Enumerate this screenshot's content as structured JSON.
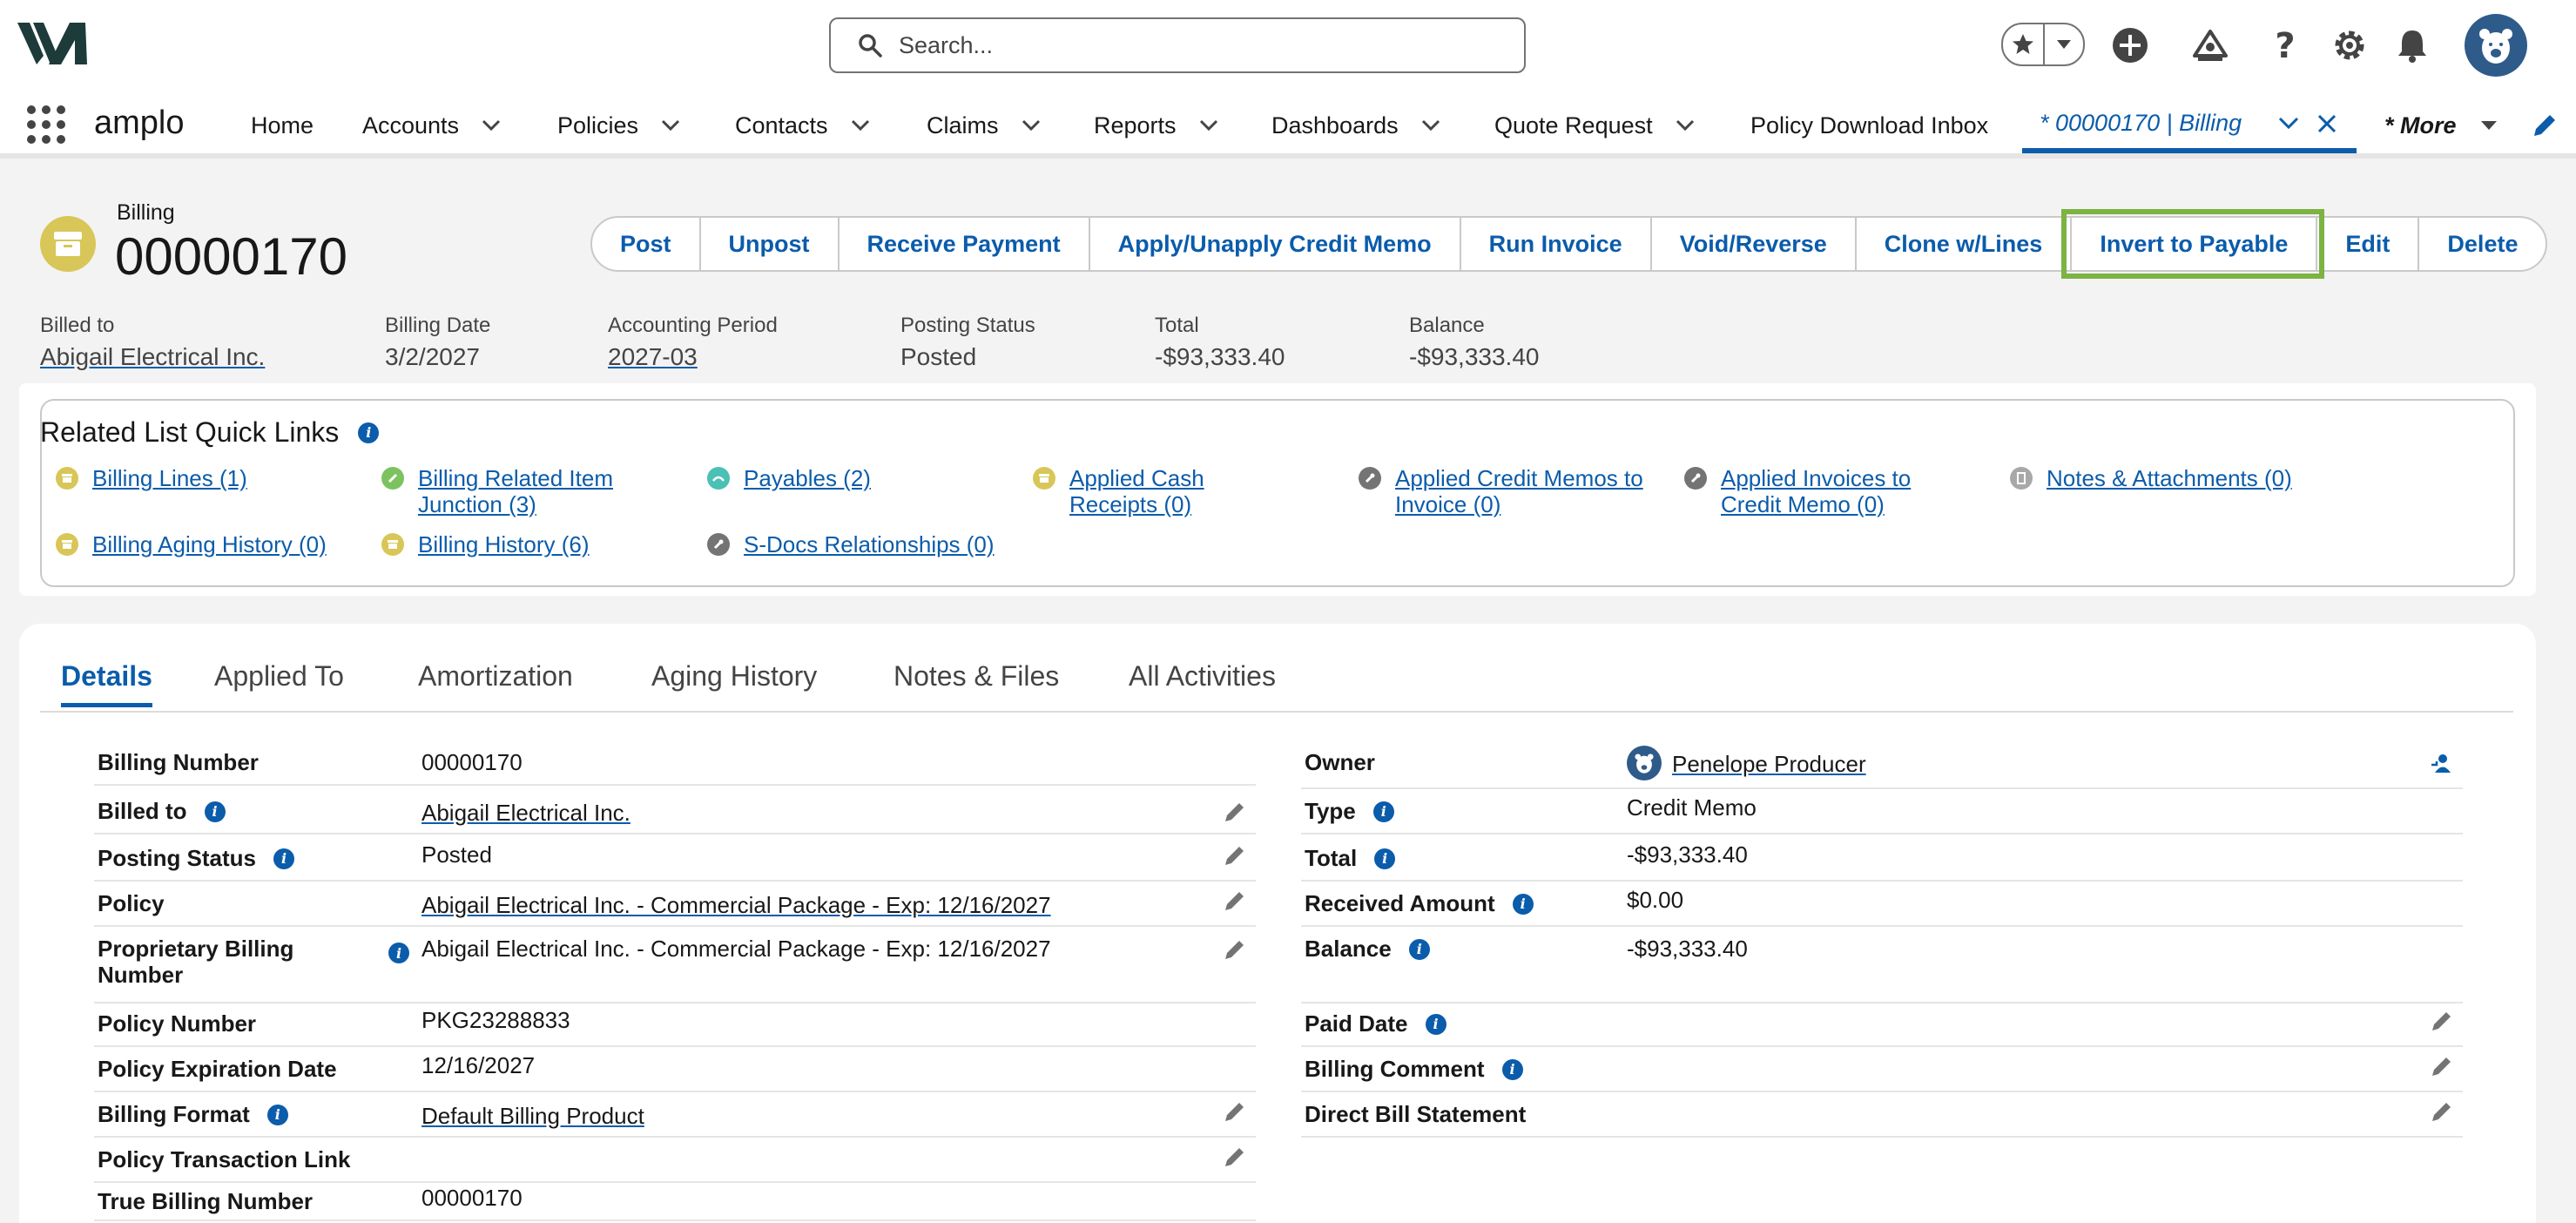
{
  "header": {
    "search_placeholder": "Search..."
  },
  "nav": {
    "app_name": "amplo",
    "items": [
      {
        "label": "Home"
      },
      {
        "label": "Accounts"
      },
      {
        "label": "Policies"
      },
      {
        "label": "Contacts"
      },
      {
        "label": "Claims"
      },
      {
        "label": "Reports"
      },
      {
        "label": "Dashboards"
      },
      {
        "label": "Quote Request"
      },
      {
        "label": "Policy Download Inbox"
      }
    ],
    "active_tab": "* 00000170 | Billing",
    "more": "* More"
  },
  "record": {
    "type": "Billing",
    "title": "00000170",
    "buttons": [
      "Post",
      "Unpost",
      "Receive Payment",
      "Apply/Unapply Credit Memo",
      "Run Invoice",
      "Void/Reverse",
      "Clone w/Lines",
      "Invert to Payable",
      "Edit",
      "Delete"
    ],
    "highlights": [
      {
        "label": "Billed to",
        "value": "Abigail Electrical Inc."
      },
      {
        "label": "Billing Date",
        "value": "3/2/2027"
      },
      {
        "label": "Accounting Period",
        "value": "2027-03"
      },
      {
        "label": "Posting Status",
        "value": "Posted"
      },
      {
        "label": "Total",
        "value": "-$93,333.40"
      },
      {
        "label": "Balance",
        "value": "-$93,333.40"
      }
    ]
  },
  "related": {
    "title": "Related List Quick Links",
    "links": [
      {
        "line1": "Billing Lines (1)",
        "line2": "",
        "color": "#d8c658"
      },
      {
        "line1": "Billing Related Item",
        "line2": "Junction (3)",
        "color": "#7cc360"
      },
      {
        "line1": "Payables (2)",
        "line2": "",
        "color": "#4bc0b4"
      },
      {
        "line1": "Applied Cash",
        "line2": "Receipts (0)",
        "color": "#d8c658"
      },
      {
        "line1": "Applied Credit Memos to",
        "line2": "Invoice (0)",
        "color": "#747474"
      },
      {
        "line1": "Applied Invoices to",
        "line2": "Credit Memo (0)",
        "color": "#747474"
      },
      {
        "line1": "Notes & Attachments (0)",
        "line2": "",
        "color": "#a8a8a8"
      },
      {
        "line1": "Billing Aging History (0)",
        "line2": "",
        "color": "#d8c658"
      },
      {
        "line1": "Billing History (6)",
        "line2": "",
        "color": "#d8c658"
      },
      {
        "line1": "S-Docs Relationships (0)",
        "line2": "",
        "color": "#747474"
      }
    ]
  },
  "tabs": [
    "Details",
    "Applied To",
    "Amortization",
    "Aging History",
    "Notes & Files",
    "All Activities"
  ],
  "details_left": [
    {
      "label": "Billing Number",
      "value": "00000170"
    },
    {
      "label": "Billed to",
      "value": "Abigail Electrical Inc."
    },
    {
      "label": "Posting Status",
      "value": "Posted"
    },
    {
      "label": "Policy",
      "value": "Abigail Electrical Inc. - Commercial Package - Exp: 12/16/2027"
    },
    {
      "label_line1": "Proprietary Billing",
      "label_line2": "Number",
      "value": "Abigail Electrical Inc. - Commercial Package - Exp: 12/16/2027"
    },
    {
      "label": "Policy Number",
      "value": "PKG23288833"
    },
    {
      "label": "Policy Expiration Date",
      "value": "12/16/2027"
    },
    {
      "label": "Billing Format",
      "value": "Default Billing Product"
    },
    {
      "label": "Policy Transaction Link",
      "value": ""
    },
    {
      "label": "True Billing Number",
      "value": "00000170"
    }
  ],
  "details_right": [
    {
      "label": "Owner",
      "value": "Penelope Producer"
    },
    {
      "label": "Type",
      "value": "Credit Memo"
    },
    {
      "label": "Total",
      "value": "-$93,333.40"
    },
    {
      "label": "Received Amount",
      "value": "$0.00"
    },
    {
      "label": "Balance",
      "value": "-$93,333.40"
    },
    {
      "label": "Paid Date",
      "value": ""
    },
    {
      "label": "Billing Comment",
      "value": ""
    },
    {
      "label": "Direct Bill Statement",
      "value": ""
    }
  ],
  "colors": {
    "brand": "#0b5cab",
    "highlight": "#7cb342",
    "billing_icon": "#d8c658"
  }
}
